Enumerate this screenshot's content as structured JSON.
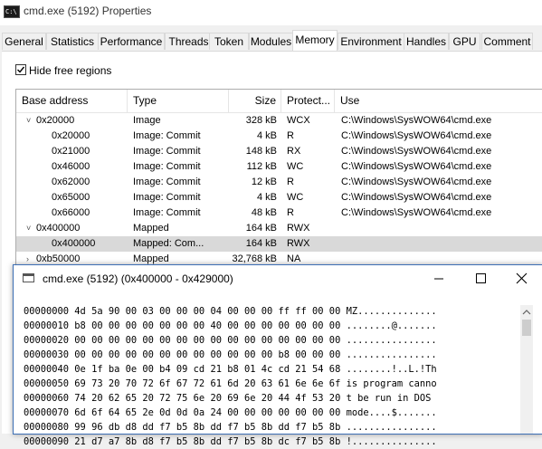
{
  "window": {
    "title": "cmd.exe (5192) Properties",
    "icon": "cmd-icon"
  },
  "tabs": [
    "General",
    "Statistics",
    "Performance",
    "Threads",
    "Token",
    "Modules",
    "Memory",
    "Environment",
    "Handles",
    "GPU",
    "Comment"
  ],
  "active_tab": "Memory",
  "hide_free": {
    "label": "Hide free regions",
    "checked": true
  },
  "columns": [
    "Base address",
    "Type",
    "Size",
    "Protect...",
    "Use"
  ],
  "rows": [
    {
      "base": "0x20000",
      "type": "Image",
      "size": "328 kB",
      "protect": "WCX",
      "use": "C:\\Windows\\SysWOW64\\cmd.exe",
      "expander": "˅",
      "indent": 0
    },
    {
      "base": "0x20000",
      "type": "Image: Commit",
      "size": "4 kB",
      "protect": "R",
      "use": "C:\\Windows\\SysWOW64\\cmd.exe",
      "expander": "",
      "indent": 1
    },
    {
      "base": "0x21000",
      "type": "Image: Commit",
      "size": "148 kB",
      "protect": "RX",
      "use": "C:\\Windows\\SysWOW64\\cmd.exe",
      "expander": "",
      "indent": 1
    },
    {
      "base": "0x46000",
      "type": "Image: Commit",
      "size": "112 kB",
      "protect": "WC",
      "use": "C:\\Windows\\SysWOW64\\cmd.exe",
      "expander": "",
      "indent": 1
    },
    {
      "base": "0x62000",
      "type": "Image: Commit",
      "size": "12 kB",
      "protect": "R",
      "use": "C:\\Windows\\SysWOW64\\cmd.exe",
      "expander": "",
      "indent": 1
    },
    {
      "base": "0x65000",
      "type": "Image: Commit",
      "size": "4 kB",
      "protect": "WC",
      "use": "C:\\Windows\\SysWOW64\\cmd.exe",
      "expander": "",
      "indent": 1
    },
    {
      "base": "0x66000",
      "type": "Image: Commit",
      "size": "48 kB",
      "protect": "R",
      "use": "C:\\Windows\\SysWOW64\\cmd.exe",
      "expander": "",
      "indent": 1
    },
    {
      "base": "0x400000",
      "type": "Mapped",
      "size": "164 kB",
      "protect": "RWX",
      "use": "",
      "expander": "˅",
      "indent": 0
    },
    {
      "base": "0x400000",
      "type": "Mapped: Com...",
      "size": "164 kB",
      "protect": "RWX",
      "use": "",
      "expander": "",
      "indent": 1,
      "selected": true
    },
    {
      "base": "0xb50000",
      "type": "Mapped",
      "size": "32,768 kB",
      "protect": "NA",
      "use": "",
      "expander": "›",
      "indent": 0
    }
  ],
  "hex_window": {
    "title": "cmd.exe (5192) (0x400000 - 0x429000)",
    "lines": [
      "00000000 4d 5a 90 00 03 00 00 00 04 00 00 00 ff ff 00 00 MZ..............",
      "00000010 b8 00 00 00 00 00 00 00 40 00 00 00 00 00 00 00 ........@.......",
      "00000020 00 00 00 00 00 00 00 00 00 00 00 00 00 00 00 00 ................",
      "00000030 00 00 00 00 00 00 00 00 00 00 00 00 b8 00 00 00 ................",
      "00000040 0e 1f ba 0e 00 b4 09 cd 21 b8 01 4c cd 21 54 68 ........!..L.!Th",
      "00000050 69 73 20 70 72 6f 67 72 61 6d 20 63 61 6e 6e 6f is program canno",
      "00000060 74 20 62 65 20 72 75 6e 20 69 6e 20 44 4f 53 20 t be run in DOS ",
      "00000070 6d 6f 64 65 2e 0d 0d 0a 24 00 00 00 00 00 00 00 mode....$.......",
      "00000080 99 96 db d8 dd f7 b5 8b dd f7 b5 8b dd f7 b5 8b ................",
      "00000090 21 d7 a7 8b d8 f7 b5 8b dd f7 b5 8b dc f7 b5 8b !..............."
    ]
  }
}
